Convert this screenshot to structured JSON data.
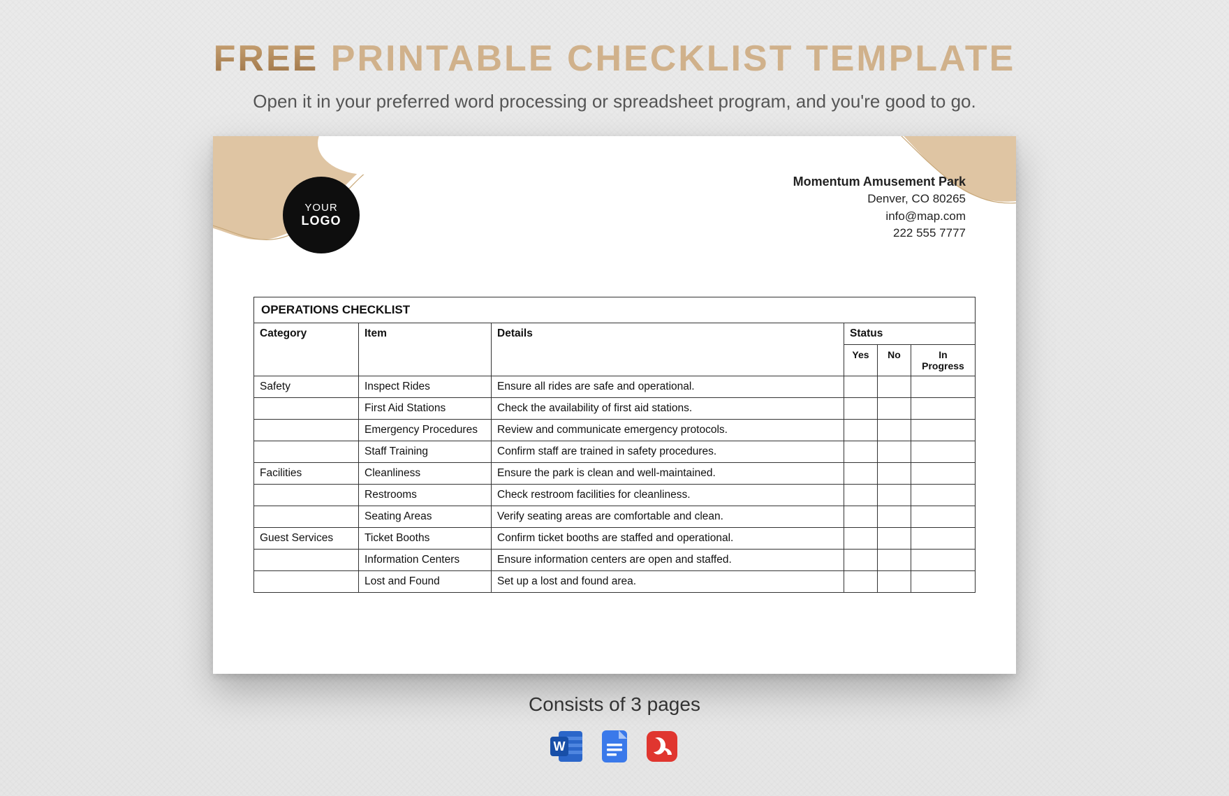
{
  "header": {
    "title_free": "FREE",
    "title_rest": " PRINTABLE CHECKLIST TEMPLATE",
    "subtitle": "Open it in your preferred word processing or spreadsheet program, and you're good to go."
  },
  "document": {
    "logo_line1": "YOUR",
    "logo_line2": "LOGO",
    "company": {
      "name": "Momentum Amusement Park",
      "address": "Denver, CO 80265",
      "email": "info@map.com",
      "phone": "222 555 7777"
    },
    "checklist_title": "OPERATIONS CHECKLIST",
    "columns": {
      "category": "Category",
      "item": "Item",
      "details": "Details",
      "status": "Status",
      "yes": "Yes",
      "no": "No",
      "in_progress": "In Progress"
    },
    "rows": [
      {
        "category": "Safety",
        "item": "Inspect Rides",
        "details": "Ensure all rides are safe and operational."
      },
      {
        "category": "",
        "item": "First Aid Stations",
        "details": "Check the availability of first aid stations."
      },
      {
        "category": "",
        "item": "Emergency Procedures",
        "details": "Review and communicate emergency protocols."
      },
      {
        "category": "",
        "item": "Staff Training",
        "details": "Confirm staff are trained in safety procedures."
      },
      {
        "category": "Facilities",
        "item": "Cleanliness",
        "details": "Ensure the park is clean and well-maintained."
      },
      {
        "category": "",
        "item": "Restrooms",
        "details": "Check restroom facilities for cleanliness."
      },
      {
        "category": "",
        "item": "Seating Areas",
        "details": "Verify seating areas are comfortable and clean."
      },
      {
        "category": "Guest Services",
        "item": "Ticket Booths",
        "details": "Confirm ticket booths are staffed and operational."
      },
      {
        "category": "",
        "item": "Information Centers",
        "details": "Ensure information centers are open and staffed."
      },
      {
        "category": "",
        "item": "Lost and Found",
        "details": "Set up a lost and found area."
      }
    ]
  },
  "footer": {
    "pages_text": "Consists of 3 pages",
    "apps": [
      "Word",
      "Google Docs",
      "PDF"
    ]
  },
  "colors": {
    "tan": "#dfc5a3",
    "tan_line": "#c8a879"
  }
}
